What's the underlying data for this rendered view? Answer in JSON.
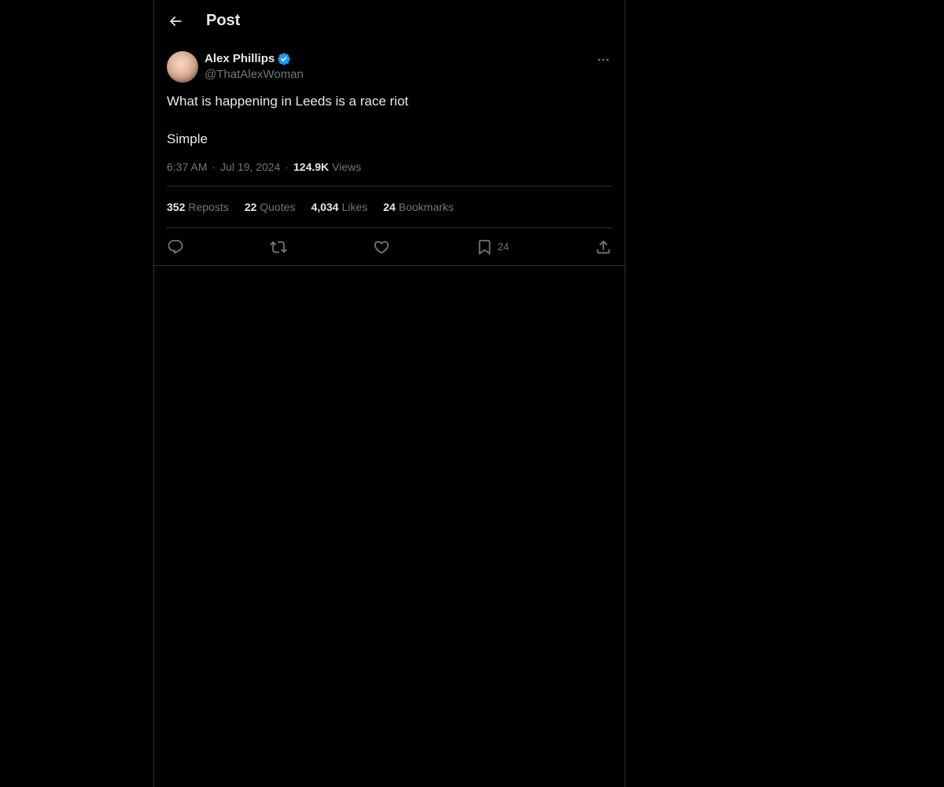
{
  "header": {
    "title": "Post"
  },
  "post": {
    "author": {
      "display_name": "Alex Phillips",
      "handle": "@ThatAlexWoman",
      "verified": true
    },
    "text": "What is happening in Leeds is a race riot\n\nSimple",
    "time": "6:37 AM",
    "date": "Jul 19, 2024",
    "views_count": "124.9K",
    "views_label": "Views",
    "separator": "·"
  },
  "stats": {
    "reposts": {
      "count": "352",
      "label": "Reposts"
    },
    "quotes": {
      "count": "22",
      "label": "Quotes"
    },
    "likes": {
      "count": "4,034",
      "label": "Likes"
    },
    "bookmarks": {
      "count": "24",
      "label": "Bookmarks"
    }
  },
  "actions": {
    "reply": {
      "icon": "reply-icon"
    },
    "repost": {
      "icon": "repost-icon"
    },
    "like": {
      "icon": "heart-icon"
    },
    "bookmark": {
      "icon": "bookmark-icon",
      "count": "24"
    },
    "share": {
      "icon": "share-icon"
    }
  },
  "colors": {
    "background": "#000000",
    "text": "#e7e9ea",
    "muted": "#71767b",
    "border": "#2f3336",
    "verified": "#1d9bf0"
  }
}
